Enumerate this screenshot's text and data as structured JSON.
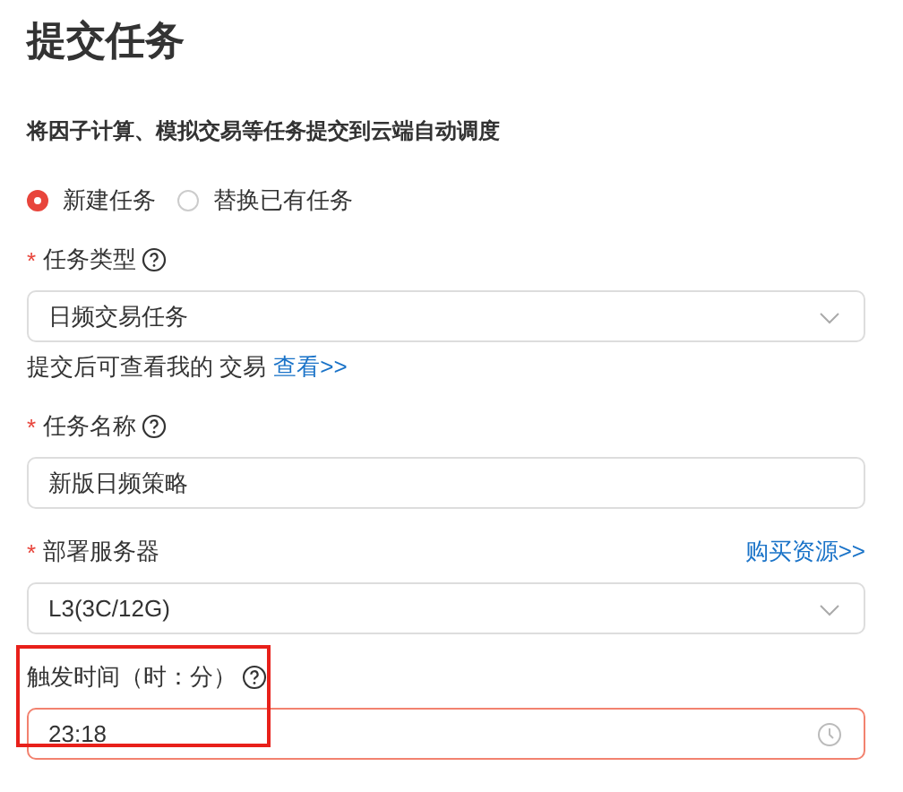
{
  "title": "提交任务",
  "description": "将因子计算、模拟交易等任务提交到云端自动调度",
  "mode_options": [
    {
      "label": "新建任务",
      "selected": true
    },
    {
      "label": "替换已有任务",
      "selected": false
    }
  ],
  "fields": [
    {
      "kind": "select",
      "label": "任务类型",
      "required_mark": "*",
      "help": true,
      "value": "日频交易任务",
      "hint": "提交后可查看我的 交易",
      "hint_link": "查看>>"
    },
    {
      "kind": "input",
      "label": "任务名称",
      "required_mark": "*",
      "help": true,
      "value": "新版日频策略"
    },
    {
      "kind": "select",
      "label": "部署服务器",
      "required_mark": "*",
      "value": "L3(3C/12G)",
      "side_link": "购买资源>>"
    },
    {
      "kind": "time",
      "label": "触发时间（时：分）",
      "help": true,
      "value": "23:18",
      "error": true,
      "highlighted": true
    }
  ]
}
